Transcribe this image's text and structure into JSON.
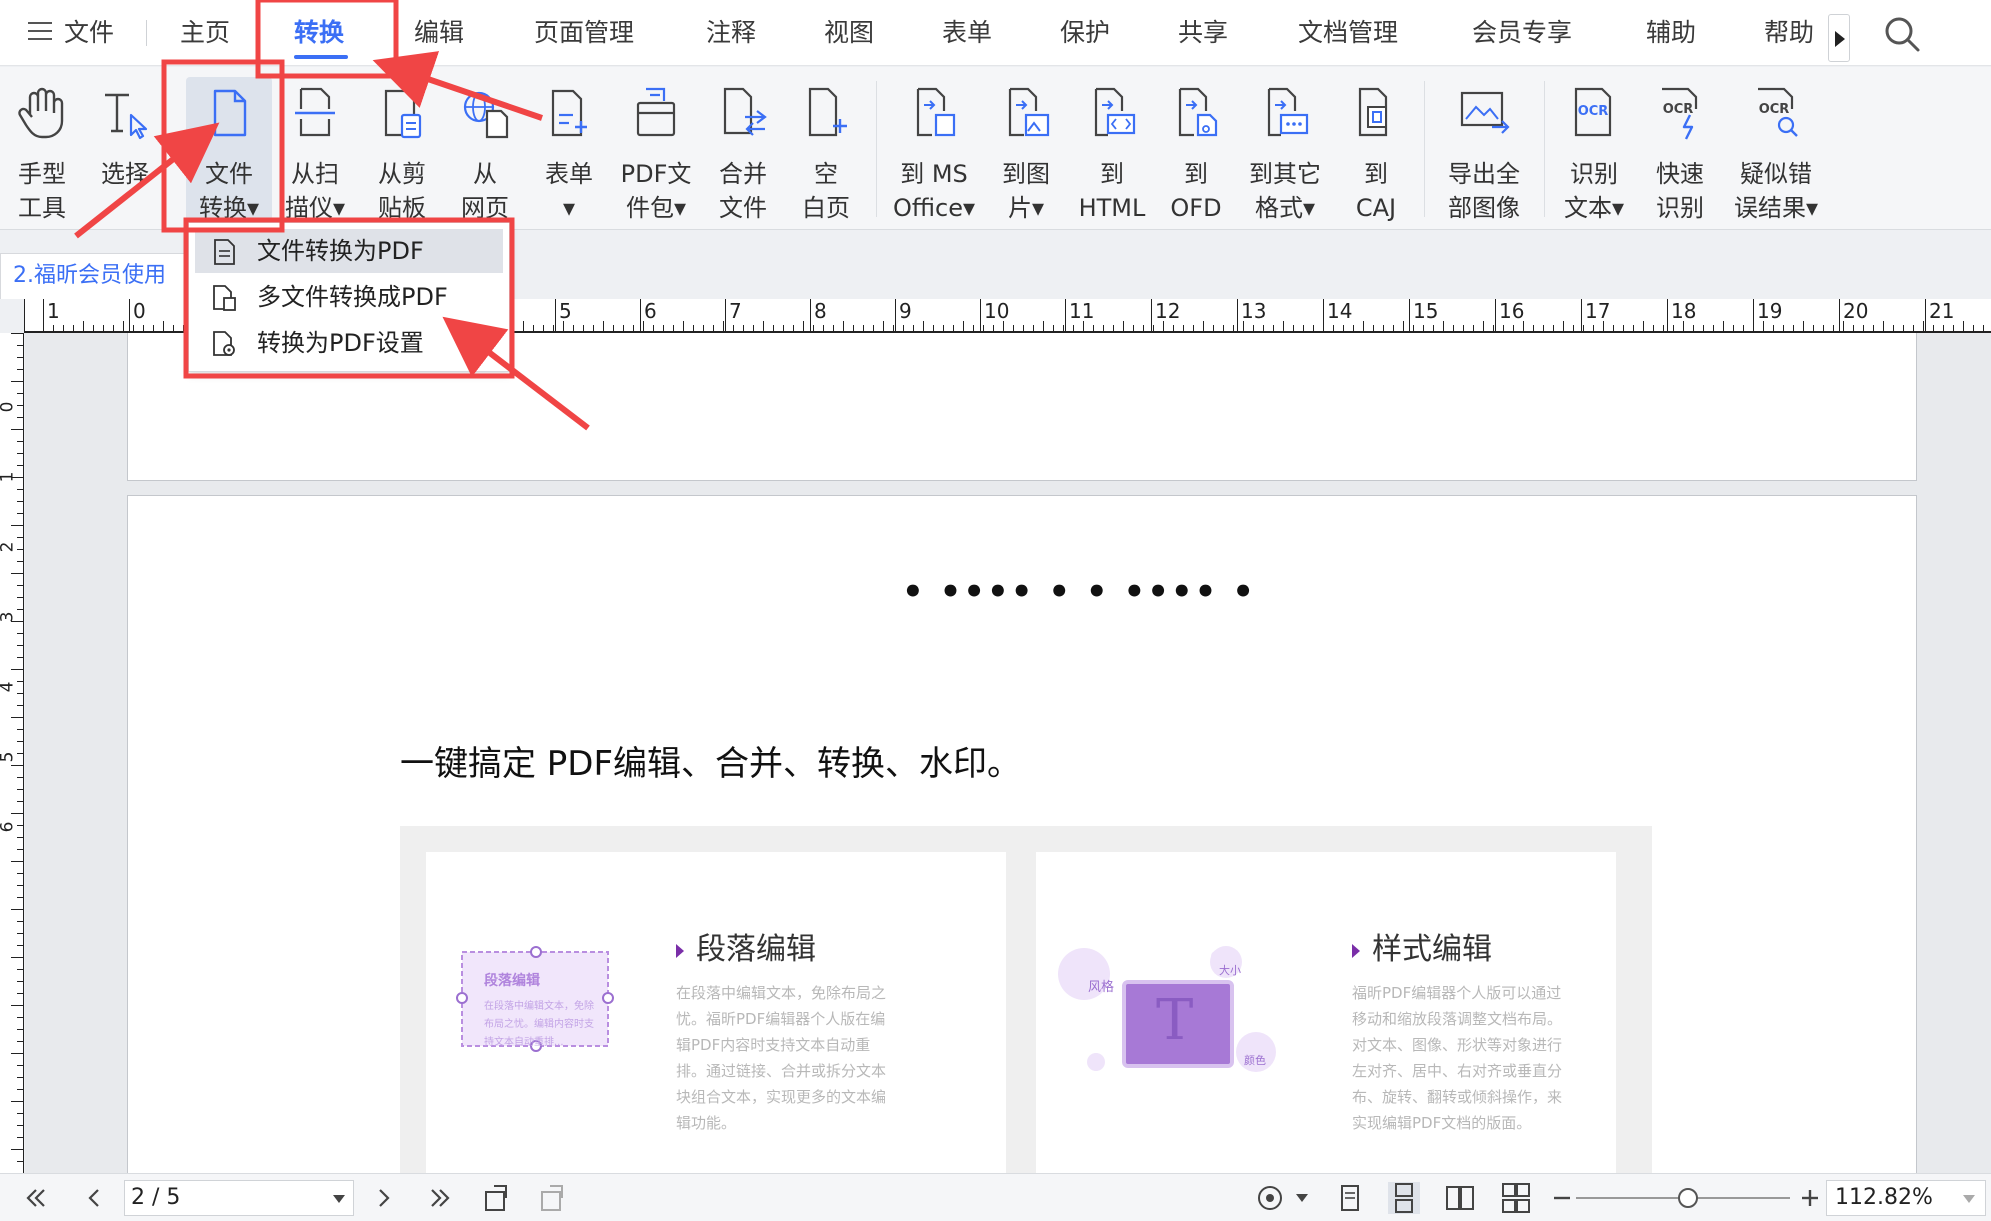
{
  "menubar": {
    "file": "文件",
    "items": [
      "主页",
      "转换",
      "编辑",
      "页面管理",
      "注释",
      "视图",
      "表单",
      "保护",
      "共享",
      "文档管理",
      "会员专享",
      "辅助",
      "帮助"
    ],
    "active": "转换"
  },
  "ribbon": {
    "hand": "手型\n工具",
    "select": "选择",
    "file_convert": "文件\n转换▾",
    "from_scanner": "从扫\n描仪▾",
    "from_clipboard": "从剪\n贴板",
    "from_webpage": "从\n网页",
    "form": "表单\n▾",
    "pdf_package": "PDF文\n件包▾",
    "merge_files": "合并\n文件",
    "blank_page": "空\n白页",
    "to_ms_office": "到 MS\nOffice▾",
    "to_image": "到图\n片▾",
    "to_html": "到\nHTML",
    "to_ofd": "到\nOFD",
    "to_other": "到其它\n格式▾",
    "to_caj": "到\nCAJ",
    "export_images": "导出全\n部图像",
    "ocr_text": "识别\n文本▾",
    "quick_ocr": "快速\n识别",
    "suspect_results": "疑似错\n误结果▾"
  },
  "dropdown": {
    "items": [
      "文件转换为PDF",
      "多文件转换成PDF",
      "转换为PDF设置"
    ]
  },
  "doc_tab": "2.福昕会员使用",
  "ruler": {
    "top": [
      "1",
      "0",
      "5",
      "6",
      "7",
      "8",
      "9",
      "10",
      "11",
      "12",
      "13",
      "14",
      "15",
      "16",
      "17",
      "18",
      "19",
      "20",
      "21"
    ],
    "left": [
      "0",
      "1",
      "2",
      "3",
      "4",
      "5",
      "6"
    ]
  },
  "page": {
    "dots": "• •••• • • •••• •",
    "headline": "一键搞定 PDF编辑、合并、转换、水印。",
    "card1": {
      "title": "段落编辑",
      "desc": "在段落中编辑文本，免除布局之忧。福昕PDF编辑器个人版在编辑PDF内容时支持文本自动重排。通过链接、合并或拆分文本块组合文本，实现更多的文本编辑功能。",
      "illustration_title": "段落编辑",
      "illustration_text": "在段落中编辑文本，免除布局之忧。编辑内容时支持文本自动重排..."
    },
    "card2": {
      "title": "样式编辑",
      "desc": "福昕PDF编辑器个人版可以通过移动和缩放段落调整文档布局。对文本、图像、形状等对象进行左对齐、居中、右对齐或垂直分布、旋转、翻转或倾斜操作，来实现编辑PDF文档的版面。",
      "bubble_style": "风格",
      "bubble_size": "大小",
      "bubble_color": "颜色",
      "glyph": "T"
    }
  },
  "statusbar": {
    "page": "2 / 5",
    "zoom": "112.82%"
  },
  "colors": {
    "accent": "#3b6ff5",
    "annotation": "#f04545",
    "purple": "#9b6fd0"
  }
}
